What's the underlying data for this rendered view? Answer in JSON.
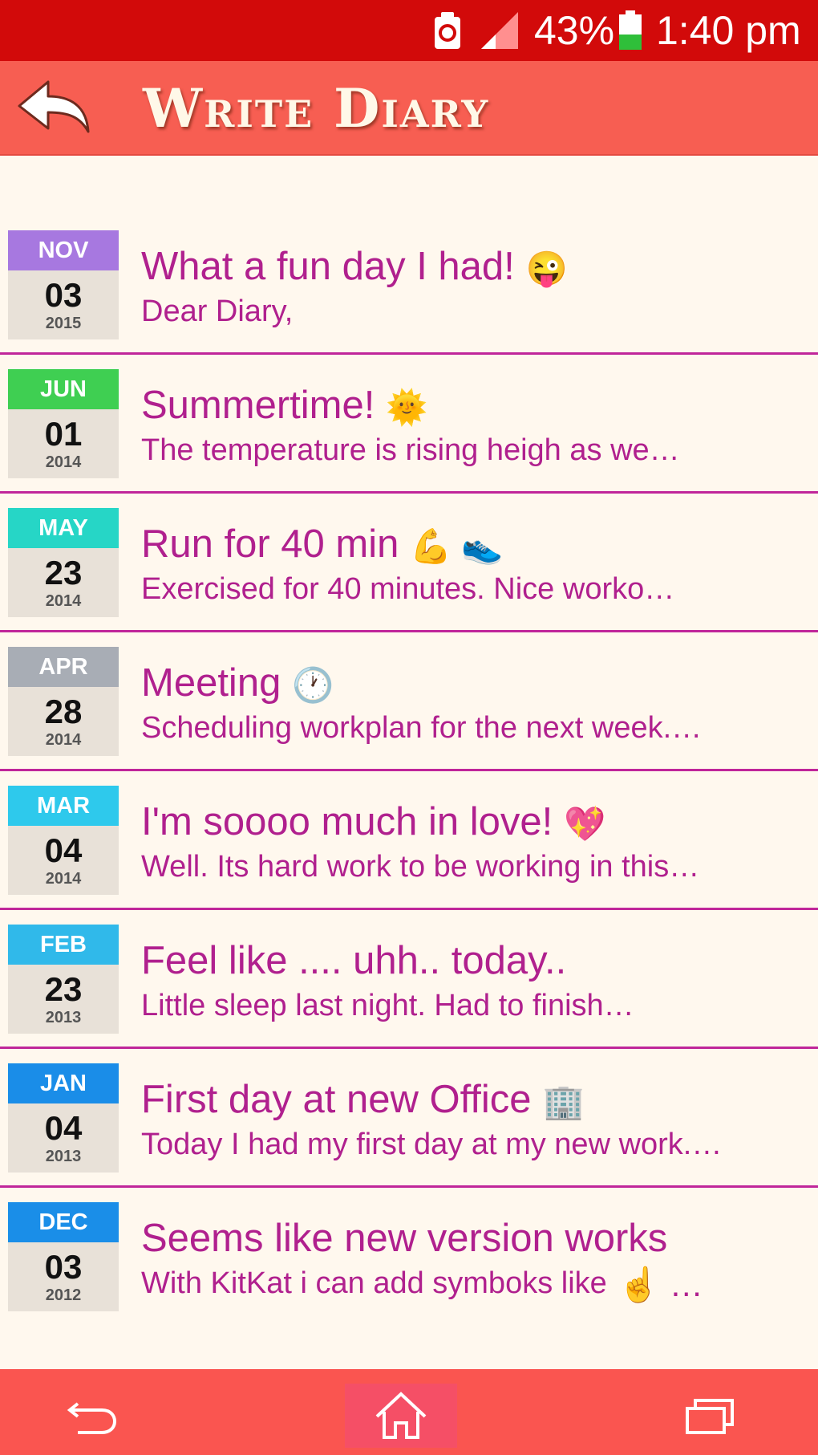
{
  "status_bar": {
    "battery_percent": "43%",
    "time": "1:40 pm"
  },
  "header": {
    "title": "Write Diary",
    "back_icon": "back-arrow-icon"
  },
  "entries": [
    {
      "month": "NOV",
      "day": "03",
      "year": "2015",
      "month_color": "#a778e0",
      "title": "What a fun day I had!",
      "title_emoji": "😜",
      "preview": "Dear Diary,",
      "preview_emoji": ""
    },
    {
      "month": "JUN",
      "day": "01",
      "year": "2014",
      "month_color": "#3fcf52",
      "title": "Summertime!",
      "title_emoji": "🌞",
      "preview": "The temperature is rising heigh as we…",
      "preview_emoji": ""
    },
    {
      "month": "MAY",
      "day": "23",
      "year": "2014",
      "month_color": "#26d6c6",
      "title": "Run for 40 min",
      "title_emoji": "💪 👟",
      "preview": "Exercised for 40 minutes. Nice worko…",
      "preview_emoji": ""
    },
    {
      "month": "APR",
      "day": "28",
      "year": "2014",
      "month_color": "#a8adb5",
      "title": "Meeting",
      "title_emoji": "🕐",
      "preview": "Scheduling workplan for the next week.…",
      "preview_emoji": ""
    },
    {
      "month": "MAR",
      "day": "04",
      "year": "2014",
      "month_color": "#2ec9ec",
      "title": "I'm soooo much in love!",
      "title_emoji": "💖",
      "preview": "Well. Its hard work to be working in this…",
      "preview_emoji": ""
    },
    {
      "month": "FEB",
      "day": "23",
      "year": "2013",
      "month_color": "#30b9ea",
      "title": "Feel like .... uhh.. today..",
      "title_emoji": "",
      "preview": "Little sleep last night. Had to finish…",
      "preview_emoji": ""
    },
    {
      "month": "JAN",
      "day": "04",
      "year": "2013",
      "month_color": "#1a8de8",
      "title": "First day at new Office",
      "title_emoji": "🏢",
      "preview": "Today I had my first day at my new work.…",
      "preview_emoji": ""
    },
    {
      "month": "DEC",
      "day": "03",
      "year": "2012",
      "month_color": "#1a8ee8",
      "title": "Seems like new version works",
      "title_emoji": "",
      "preview": "With KitKat i can add symboks like",
      "preview_emoji": "☝ …"
    }
  ],
  "nav_bar": {
    "back_icon": "nav-back-icon",
    "home_icon": "home-icon",
    "recents_icon": "recents-icon"
  }
}
